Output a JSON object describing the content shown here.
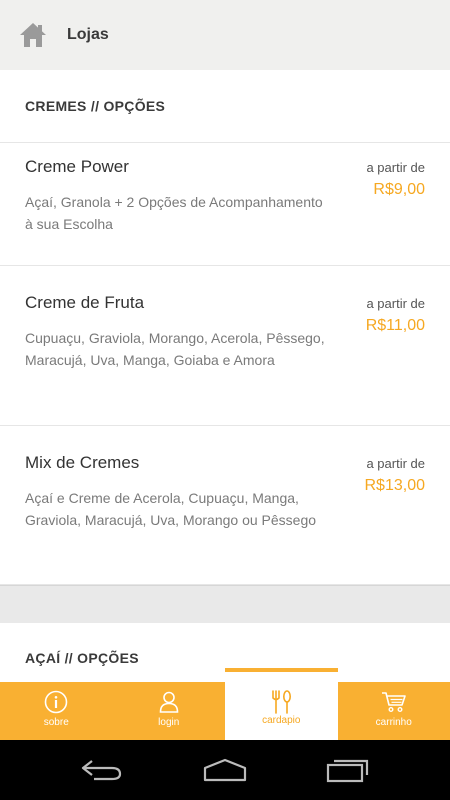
{
  "header": {
    "title": "Lojas",
    "home_icon": "home-icon"
  },
  "sections": [
    {
      "title": "CREMES // OPÇÕES",
      "items": [
        {
          "name": "Creme Power",
          "desc": "Açaí, Granola + 2 Opções de Acompanhamento à sua Escolha",
          "from": "a partir de",
          "price": "R$9,00"
        },
        {
          "name": "Creme de Fruta",
          "desc": "Cupuaçu, Graviola, Morango, Acerola, Pêssego, Maracujá, Uva, Manga, Goiaba e Amora",
          "from": "a partir de",
          "price": "R$11,00"
        },
        {
          "name": "Mix de Cremes",
          "desc": "Açaí e Creme de Acerola, Cupuaçu, Manga, Graviola, Maracujá, Uva, Morango ou Pêssego",
          "from": "a partir de",
          "price": "R$13,00"
        }
      ]
    },
    {
      "title": "AÇAÍ // OPÇÕES"
    }
  ],
  "tabs": [
    {
      "label": "sobre",
      "icon": "info-icon"
    },
    {
      "label": "login",
      "icon": "user-icon"
    },
    {
      "label": "cardapio",
      "icon": "cutlery-icon",
      "active": true
    },
    {
      "label": "carrinho",
      "icon": "cart-icon"
    }
  ],
  "colors": {
    "accent": "#f9b032",
    "price": "#f6a821",
    "topbar": "#f0f0ee"
  }
}
